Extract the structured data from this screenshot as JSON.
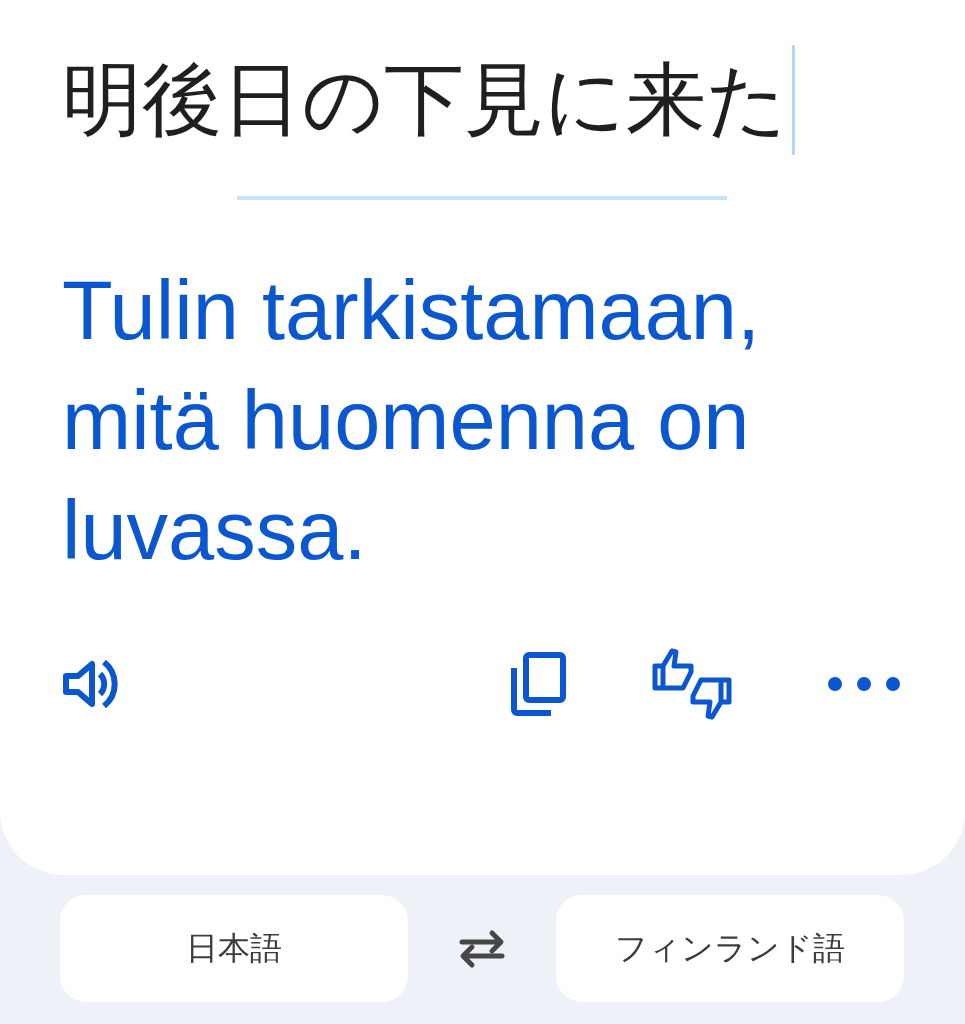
{
  "source": {
    "text": "明後日の下見に来た"
  },
  "translation": {
    "text": "Tulin tarkistamaan, mitä huomenna on luvassa."
  },
  "actions": [
    {
      "kind": "listen"
    },
    {
      "kind": "copy"
    },
    {
      "kind": "feedback"
    },
    {
      "kind": "more"
    }
  ],
  "languages": {
    "source": "日本語",
    "target": "フィンランド語"
  }
}
